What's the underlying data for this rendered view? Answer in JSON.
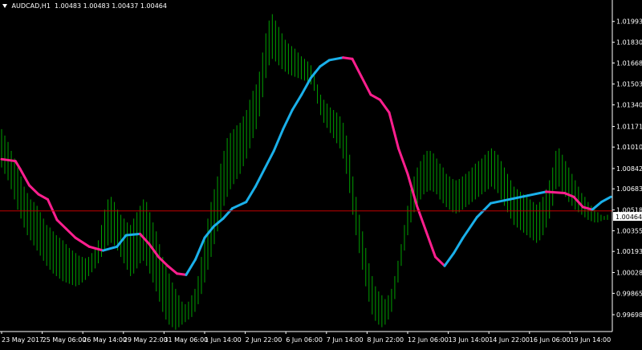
{
  "header": {
    "symbol": "AUDCAD,H1",
    "ohlc": "1.00483 1.00483 1.00437 1.00464",
    "menu_icon": "triangle-down-icon"
  },
  "colors": {
    "background": "#000000",
    "bars": "#00a000",
    "trend_up": "#1ab0ea",
    "trend_down": "#ff1f8e",
    "trend_flat": "#ffffff",
    "price_line": "#c00000",
    "axis": "#ffffff"
  },
  "chart_data": {
    "type": "line",
    "title": "AUDCAD,H1",
    "ylim": [
      0.99566,
      1.02073
    ],
    "y_ticks": [
      "1.01993",
      "1.01830",
      "1.01668",
      "1.01503",
      "1.01340",
      "1.01171",
      "1.01010",
      "1.00842",
      "1.00683",
      "1.00518",
      "1.00355",
      "1.00193",
      "1.00028",
      "0.99865",
      "0.99698"
    ],
    "x_tick_labels": [
      "23 May 2017",
      "25 May 06:00",
      "26 May 14:00",
      "29 May 22:00",
      "31 May 06:00",
      "1 Jun 14:00",
      "2 Jun 22:00",
      "6 Jun 06:00",
      "7 Jun 14:00",
      "8 Jun 22:00",
      "12 Jun 06:00",
      "13 Jun 14:00",
      "14 Jun 22:00",
      "16 Jun 06:00",
      "19 Jun 14:00"
    ],
    "current_price": "1.00464",
    "price_line_value": 1.0051,
    "series": [
      {
        "type": "bar",
        "x": [
          0,
          1,
          2,
          3,
          4,
          5,
          6,
          7,
          8,
          9,
          10,
          11,
          12,
          13,
          14,
          15,
          16,
          17,
          18,
          19,
          20,
          21,
          22,
          23,
          24,
          25,
          26,
          27,
          28,
          29,
          30,
          31,
          32,
          33,
          34,
          35,
          36,
          37,
          38,
          39,
          40,
          41,
          42,
          43,
          44,
          45,
          46,
          47,
          48,
          49,
          50,
          51,
          52,
          53,
          54,
          55,
          56,
          57,
          58,
          59,
          60,
          61,
          62,
          63,
          64,
          65,
          66,
          67,
          68,
          69,
          70,
          71,
          72,
          73,
          74,
          75,
          76,
          77,
          78,
          79,
          80,
          81,
          82,
          83,
          84,
          85,
          86,
          87,
          88,
          89,
          90,
          91,
          92,
          93,
          94,
          95,
          96,
          97,
          98,
          99,
          100,
          101,
          102,
          103,
          104,
          105,
          106,
          107,
          108,
          109,
          110,
          111,
          112,
          113,
          114,
          115,
          116,
          117,
          118,
          119,
          120,
          121,
          122,
          123,
          124,
          125,
          126,
          127,
          128,
          129,
          130,
          131,
          132,
          133,
          134,
          135,
          136,
          137,
          138,
          139,
          140,
          141,
          142,
          143,
          144,
          145,
          146,
          147,
          148,
          149,
          150,
          151,
          152,
          153,
          154,
          155,
          156,
          157,
          158,
          159,
          160,
          161,
          162,
          163,
          164,
          165,
          166,
          167,
          168,
          169,
          170,
          171,
          172,
          173,
          174,
          175,
          176,
          177,
          178,
          179,
          180,
          181,
          182,
          183,
          184,
          185,
          186,
          187,
          188
        ],
        "high": [
          1.0115,
          1.011,
          1.0105,
          1.0098,
          1.0092,
          1.0085,
          1.0078,
          1.007,
          1.0065,
          1.006,
          1.0058,
          1.0055,
          1.005,
          1.0045,
          1.004,
          1.0038,
          1.0035,
          1.0032,
          1.003,
          1.0028,
          1.0025,
          1.0022,
          1.002,
          1.0018,
          1.0016,
          1.0015,
          1.0014,
          1.0015,
          1.0018,
          1.0022,
          1.0028,
          1.004,
          1.0052,
          1.006,
          1.0062,
          1.0058,
          1.0052,
          1.0048,
          1.0045,
          1.0042,
          1.004,
          1.0045,
          1.005,
          1.0055,
          1.006,
          1.0058,
          1.005,
          1.0042,
          1.0035,
          1.0025,
          1.0015,
          1.0008,
          1.0002,
          0.9995,
          0.999,
          0.9985,
          0.998,
          0.9978,
          0.998,
          0.9985,
          0.999,
          1.0,
          1.0015,
          1.003,
          1.0045,
          1.0058,
          1.0068,
          1.0078,
          1.0088,
          1.0098,
          1.0108,
          1.0112,
          1.0115,
          1.0118,
          1.012,
          1.0125,
          1.013,
          1.0138,
          1.0145,
          1.015,
          1.016,
          1.0175,
          1.019,
          1.02,
          1.0205,
          1.02,
          1.0195,
          1.019,
          1.0185,
          1.0182,
          1.018,
          1.0178,
          1.0175,
          1.0172,
          1.017,
          1.0168,
          1.0165,
          1.016,
          1.015,
          1.0142,
          1.0138,
          1.0135,
          1.0132,
          1.013,
          1.0128,
          1.0125,
          1.012,
          1.011,
          1.0095,
          1.0078,
          1.0062,
          1.0048,
          1.0035,
          1.0022,
          1.001,
          1.0,
          0.9992,
          0.9988,
          0.9985,
          0.9982,
          0.9985,
          0.999,
          1.0,
          1.0012,
          1.0025,
          1.004,
          1.0055,
          1.0068,
          1.0078,
          1.0085,
          1.009,
          1.0095,
          1.0098,
          1.0098,
          1.0096,
          1.0092,
          1.0088,
          1.0085,
          1.008,
          1.0078,
          1.0076,
          1.0075,
          1.0076,
          1.0078,
          1.008,
          1.0082,
          1.0085,
          1.0088,
          1.009,
          1.0092,
          1.0095,
          1.0098,
          1.01,
          1.0098,
          1.0095,
          1.009,
          1.0085,
          1.008,
          1.0075,
          1.007,
          1.0068,
          1.0066,
          1.0064,
          1.0062,
          1.006,
          1.0058,
          1.0056,
          1.0058,
          1.0062,
          1.0068,
          1.0075,
          1.0085,
          1.0098,
          1.01,
          1.0095,
          1.009,
          1.0085,
          1.008,
          1.0075,
          1.007,
          1.0065,
          1.0062,
          1.0058,
          1.0055,
          1.0052,
          1.005,
          1.0048,
          1.0047,
          1.0048
        ],
        "low": [
          1.0085,
          1.008,
          1.0075,
          1.0068,
          1.006,
          1.0052,
          1.0045,
          1.0038,
          1.0032,
          1.0028,
          1.0024,
          1.002,
          1.0016,
          1.0012,
          1.0008,
          1.0005,
          1.0002,
          1.0,
          0.9998,
          0.9996,
          0.9995,
          0.9994,
          0.9993,
          0.9992,
          0.9993,
          0.9995,
          0.9997,
          1.0,
          1.0003,
          1.0006,
          1.001,
          1.0015,
          1.002,
          1.0024,
          1.0026,
          1.0024,
          1.002,
          1.0015,
          1.001,
          1.0005,
          1.0,
          1.0002,
          1.0006,
          1.001,
          1.0012,
          1.0008,
          1.0002,
          0.9995,
          0.9988,
          0.998,
          0.9972,
          0.9966,
          0.9962,
          0.996,
          0.9958,
          0.996,
          0.9962,
          0.9964,
          0.9966,
          0.9968,
          0.9972,
          0.9978,
          0.9986,
          0.9995,
          1.0005,
          1.0015,
          1.0025,
          1.0035,
          1.0045,
          1.0055,
          1.0062,
          1.0068,
          1.0072,
          1.0076,
          1.008,
          1.0086,
          1.0092,
          1.01,
          1.0108,
          1.0115,
          1.0125,
          1.014,
          1.0155,
          1.0165,
          1.017,
          1.0168,
          1.0165,
          1.0162,
          1.016,
          1.0158,
          1.0157,
          1.0156,
          1.0155,
          1.0154,
          1.0153,
          1.0152,
          1.015,
          1.0145,
          1.0135,
          1.0126,
          1.012,
          1.0116,
          1.0112,
          1.0108,
          1.0104,
          1.01,
          1.0092,
          1.008,
          1.0065,
          1.0048,
          1.0032,
          1.0018,
          1.0005,
          0.9992,
          0.998,
          0.997,
          0.9965,
          0.9962,
          0.996,
          0.9962,
          0.9966,
          0.9972,
          0.9982,
          0.9995,
          1.0008,
          1.002,
          1.0032,
          1.0042,
          1.005,
          1.0056,
          1.006,
          1.0064,
          1.0066,
          1.0067,
          1.0066,
          1.0064,
          1.006,
          1.0057,
          1.0054,
          1.0052,
          1.005,
          1.0049,
          1.005,
          1.0052,
          1.0054,
          1.0056,
          1.0058,
          1.006,
          1.0062,
          1.0064,
          1.0066,
          1.0068,
          1.007,
          1.0068,
          1.0065,
          1.006,
          1.0055,
          1.005,
          1.0045,
          1.004,
          1.0038,
          1.0036,
          1.0034,
          1.0032,
          1.003,
          1.0028,
          1.0026,
          1.0028,
          1.0032,
          1.0038,
          1.0045,
          1.0055,
          1.0068,
          1.007,
          1.0066,
          1.0062,
          1.0058,
          1.0055,
          1.0052,
          1.005,
          1.0048,
          1.0046,
          1.0044,
          1.0043,
          1.0042,
          1.0042,
          1.0043,
          1.0044,
          1.0044
        ]
      },
      {
        "type": "trend-line",
        "points": [
          [
            0,
            1.00915
          ],
          [
            6,
            1.009
          ],
          [
            8,
            1.0084
          ],
          [
            12,
            1.0071
          ],
          [
            16,
            1.0064
          ],
          [
            20,
            1.006
          ],
          [
            24,
            1.0044
          ],
          [
            28,
            1.0037
          ],
          [
            32,
            1.003
          ],
          [
            38,
            1.0023
          ],
          [
            44,
            1.002
          ],
          [
            50,
            1.0023
          ],
          [
            54,
            1.0032
          ],
          [
            60,
            1.0033
          ],
          [
            64,
            1.0025
          ],
          [
            68,
            1.0015
          ],
          [
            72,
            1.0008
          ],
          [
            76,
            1.0002
          ],
          [
            80,
            1.0001
          ],
          [
            84,
            1.0013
          ],
          [
            88,
            1.003
          ],
          [
            92,
            1.0039
          ],
          [
            96,
            1.0045
          ],
          [
            100,
            1.0053
          ],
          [
            106,
            1.0058
          ],
          [
            110,
            1.007
          ],
          [
            114,
            1.0084
          ],
          [
            118,
            1.0098
          ],
          [
            122,
            1.0115
          ],
          [
            126,
            1.013
          ],
          [
            130,
            1.0142
          ],
          [
            134,
            1.0155
          ],
          [
            138,
            1.0164
          ],
          [
            142,
            1.0169
          ],
          [
            148,
            1.0171
          ],
          [
            152,
            1.017
          ],
          [
            156,
            1.0156
          ],
          [
            160,
            1.0142
          ],
          [
            164,
            1.0138
          ],
          [
            168,
            1.0128
          ],
          [
            172,
            1.01
          ],
          [
            176,
            1.008
          ],
          [
            180,
            1.0055
          ],
          [
            184,
            1.0035
          ],
          [
            188,
            1.0015
          ],
          [
            192,
            1.0008
          ],
          [
            196,
            1.0018
          ],
          [
            200,
            1.003
          ],
          [
            206,
            1.0046
          ],
          [
            212,
            1.0057
          ],
          [
            220,
            1.006
          ],
          [
            228,
            1.0063
          ],
          [
            236,
            1.0066
          ],
          [
            244,
            1.0065
          ],
          [
            248,
            1.0062
          ],
          [
            252,
            1.0054
          ],
          [
            256,
            1.0052
          ],
          [
            260,
            1.0058
          ],
          [
            264,
            1.0062
          ]
        ]
      }
    ]
  }
}
